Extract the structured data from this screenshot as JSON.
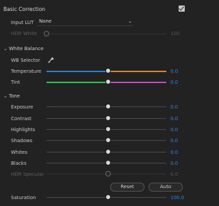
{
  "panel": {
    "title": "Basic Correction",
    "enabled": true
  },
  "input_lut": {
    "label": "Input LUT",
    "value": "None"
  },
  "hdr_white": {
    "label": "HDR White",
    "value": "100"
  },
  "white_balance": {
    "section_label": "White Balance",
    "wb_selector_label": "WB Selector",
    "temperature": {
      "label": "Temperature",
      "value": "0.0"
    },
    "tint": {
      "label": "Tint",
      "value": "0.0"
    }
  },
  "tone": {
    "section_label": "Tone",
    "sliders": [
      {
        "label": "Exposure",
        "value": "0.0"
      },
      {
        "label": "Contrast",
        "value": "0.0"
      },
      {
        "label": "Highlights",
        "value": "0.0"
      },
      {
        "label": "Shadows",
        "value": "0.0"
      },
      {
        "label": "Whites",
        "value": "0.0"
      },
      {
        "label": "Blacks",
        "value": "0.0"
      },
      {
        "label": "HDR Specular",
        "value": "0.0"
      }
    ],
    "reset_label": "Reset",
    "auto_label": "Auto"
  },
  "saturation": {
    "label": "Saturation",
    "value": "100.0"
  },
  "colors": {
    "accent": "#2f86d9",
    "temperature_left": "#2f7fd0",
    "temperature_right": "#d9892a",
    "tint_left": "#2fc75a",
    "tint_right": "#c64bc6"
  }
}
